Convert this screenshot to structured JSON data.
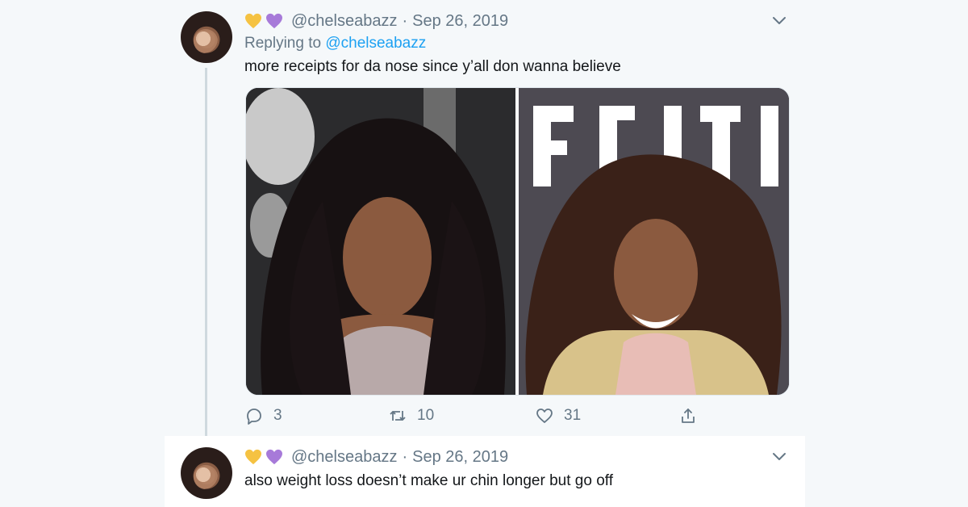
{
  "colors": {
    "background": "#f5f8fa",
    "text": "#14171a",
    "muted": "#657786",
    "link": "#1da1f2",
    "heart_yellow": "#f5c242",
    "heart_purple": "#a77ad9"
  },
  "tweets": [
    {
      "emoji_icons": [
        "yellow-heart-icon",
        "purple-heart-icon"
      ],
      "handle": "@chelseabazz",
      "separator": "·",
      "date": "Sep 26, 2019",
      "replying_prefix": "Replying to",
      "replying_to": "@chelseabazz",
      "text": "more receipts for da nose since y’all don wanna believe",
      "actions": {
        "replies": "3",
        "retweets": "10",
        "likes": "31"
      },
      "media_icons": [
        "photo-left",
        "photo-right"
      ]
    },
    {
      "emoji_icons": [
        "yellow-heart-icon",
        "purple-heart-icon"
      ],
      "handle": "@chelseabazz",
      "separator": "·",
      "date": "Sep 26, 2019",
      "text": "also weight loss doesn’t make ur chin longer but go off"
    }
  ]
}
